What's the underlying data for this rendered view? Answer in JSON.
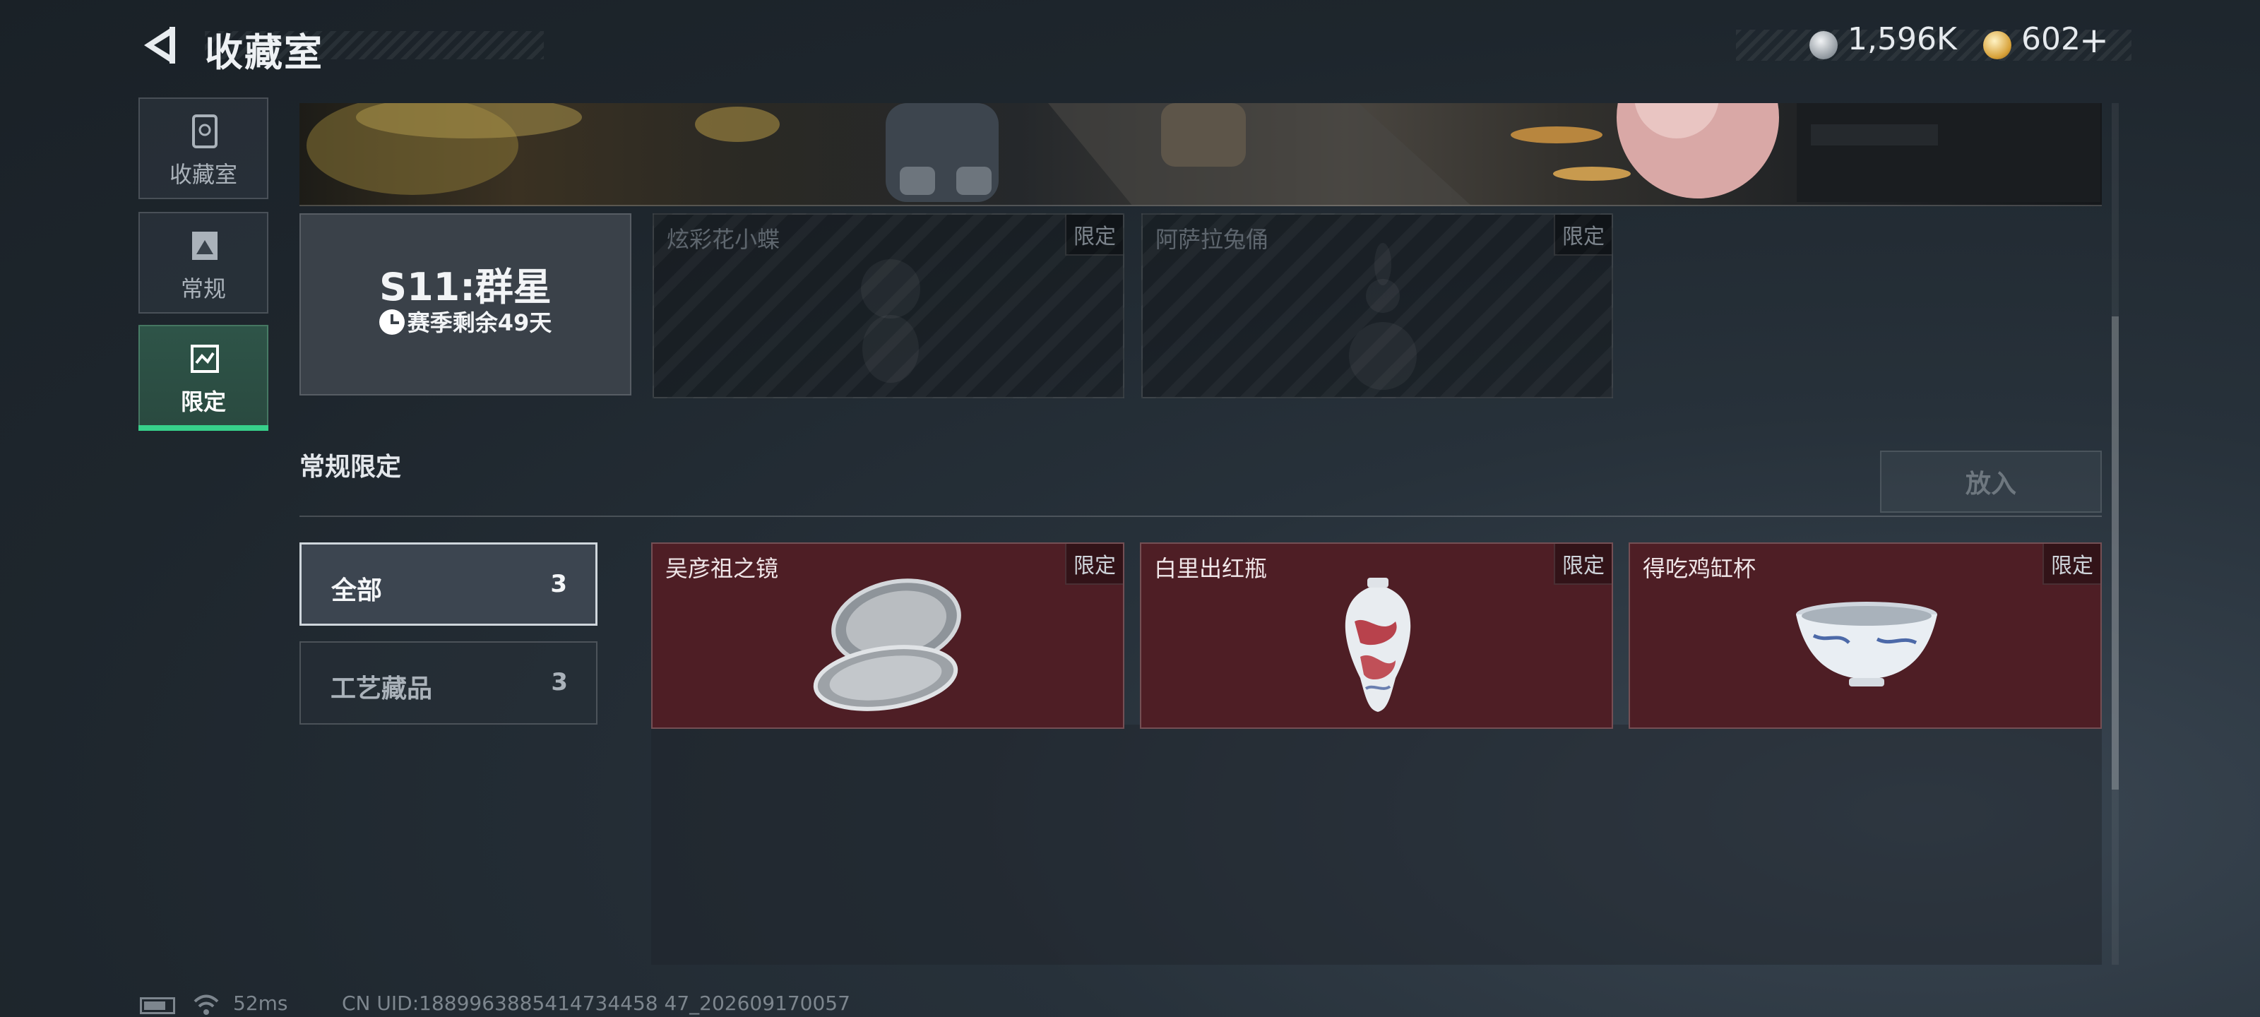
{
  "header": {
    "title": "收藏室",
    "currencies": [
      {
        "icon": "silver-coin-icon",
        "value": "1,596K"
      },
      {
        "icon": "gold-coin-icon",
        "value": "602",
        "add": "+"
      }
    ]
  },
  "sidebar": {
    "tabs": [
      {
        "label": "收藏室",
        "icon": "collection-icon",
        "active": false
      },
      {
        "label": "常规",
        "icon": "regular-icon",
        "active": false
      },
      {
        "label": "限定",
        "icon": "limited-icon",
        "active": true
      }
    ]
  },
  "season": {
    "name": "S11:群星",
    "remaining": "赛季剩余49天"
  },
  "season_items": [
    {
      "name": "炫彩花小蝶",
      "tag": "限定"
    },
    {
      "name": "阿萨拉兔俑",
      "tag": "限定"
    }
  ],
  "section": {
    "title": "常规限定",
    "put_button": "放入"
  },
  "filters": [
    {
      "label": "全部",
      "count": "3",
      "selected": true
    },
    {
      "label": "工艺藏品",
      "count": "3",
      "selected": false
    }
  ],
  "items": [
    {
      "name": "吴彦祖之镜",
      "tag": "限定",
      "icon": "mirror-icon"
    },
    {
      "name": "白里出红瓶",
      "tag": "限定",
      "icon": "vase-icon"
    },
    {
      "name": "得吃鸡缸杯",
      "tag": "限定",
      "icon": "cup-icon"
    }
  ],
  "status": {
    "ping": "52ms",
    "uid": "CN UID:1889963885414734458 47_202609170057"
  },
  "colors": {
    "accent": "#37d08a",
    "item_bg": "#4e1e25"
  }
}
